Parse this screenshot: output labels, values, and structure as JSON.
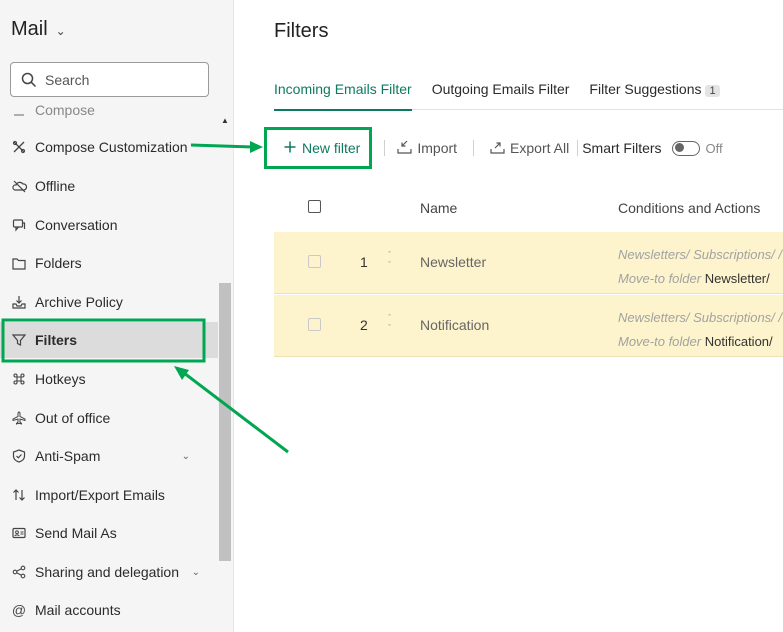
{
  "app": {
    "title": "Mail"
  },
  "search": {
    "placeholder": "Search"
  },
  "sidebar": {
    "items": [
      {
        "label": "Compose",
        "icon": "compose-icon"
      },
      {
        "label": "Compose Customization",
        "icon": "customization-icon"
      },
      {
        "label": "Offline",
        "icon": "offline-icon"
      },
      {
        "label": "Conversation",
        "icon": "conversation-icon"
      },
      {
        "label": "Folders",
        "icon": "folder-icon"
      },
      {
        "label": "Archive Policy",
        "icon": "archive-icon"
      },
      {
        "label": "Filters",
        "icon": "filter-icon",
        "active": true
      },
      {
        "label": "Hotkeys",
        "icon": "command-key-icon"
      },
      {
        "label": "Out of office",
        "icon": "airplane-icon"
      },
      {
        "label": "Anti-Spam",
        "icon": "shield-check-icon"
      },
      {
        "label": "Import/Export Emails",
        "icon": "import-export-icon"
      },
      {
        "label": "Send Mail As",
        "icon": "send-mail-as-icon"
      },
      {
        "label": "Sharing and delegation",
        "icon": "share-icon"
      },
      {
        "label": "Mail accounts",
        "icon": "at-icon"
      }
    ]
  },
  "main": {
    "title": "Filters",
    "tabs": [
      {
        "label": "Incoming Emails Filter",
        "active": true
      },
      {
        "label": "Outgoing Emails Filter"
      },
      {
        "label": "Filter Suggestions",
        "badge": "1"
      }
    ],
    "toolbar": {
      "new_filter": "New filter",
      "import": "Import",
      "export_all": "Export All",
      "smart_filters": "Smart Filters",
      "smart_filters_state": "Off"
    },
    "table": {
      "columns": [
        "Name",
        "Conditions and Actions"
      ],
      "rows": [
        {
          "index": "1",
          "name": "Newsletter",
          "condition": "Newsletters/ Subscriptions/ /",
          "action_prefix": "Move-to folder",
          "action_folder": "Newsletter/"
        },
        {
          "index": "2",
          "name": "Notification",
          "condition": "Newsletters/ Subscriptions/ /",
          "action_prefix": "Move-to folder",
          "action_folder": "Notification/"
        }
      ]
    }
  },
  "colors": {
    "accent": "#0d7a5f",
    "highlight_box": "#00a651",
    "row_background": "#fdf3cc",
    "sidebar_background": "#f5f5f5",
    "active_item_background": "#dcdcdc"
  }
}
